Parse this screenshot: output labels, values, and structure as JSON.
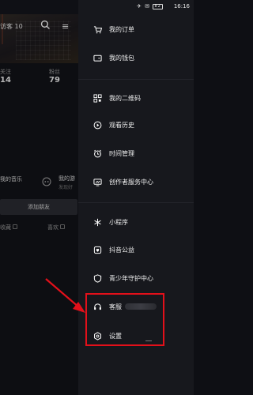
{
  "status_bar": {
    "time": "16:16",
    "battery": "82"
  },
  "profile": {
    "visitor_label": "访客 10",
    "stats": [
      {
        "label": "关注",
        "value": "14"
      },
      {
        "label": "粉丝",
        "value": "79"
      }
    ],
    "music_title": "我的音乐",
    "game_title": "我的游",
    "game_sub": "发现好",
    "add_friend_button": "添加朋友",
    "tabs": [
      "收藏",
      "喜欢"
    ]
  },
  "drawer": {
    "items": [
      {
        "label": "我的订单",
        "icon": "cart-icon"
      },
      {
        "label": "我的钱包",
        "icon": "wallet-icon"
      },
      {
        "label": "我的二维码",
        "icon": "qrcode-icon"
      },
      {
        "label": "观看历史",
        "icon": "history-icon"
      },
      {
        "label": "时间管理",
        "icon": "alarm-clock-icon"
      },
      {
        "label": "创作者服务中心",
        "icon": "creator-icon"
      },
      {
        "label": "小程序",
        "icon": "mini-program-icon"
      },
      {
        "label": "抖音公益",
        "icon": "charity-icon"
      },
      {
        "label": "青少年守护中心",
        "icon": "youth-guard-icon"
      },
      {
        "label": "客服",
        "icon": "headset-icon"
      },
      {
        "label": "设置",
        "icon": "settings-icon"
      }
    ]
  },
  "colors": {
    "drawer_bg": "#17181d",
    "highlight": "#e3101a",
    "arrow": "#e3101a"
  }
}
